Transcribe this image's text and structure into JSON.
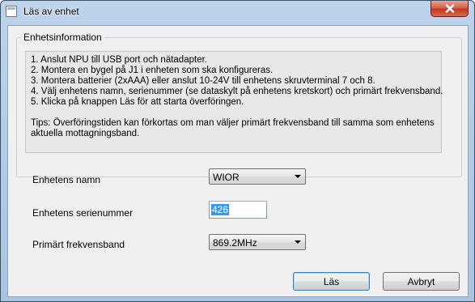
{
  "window": {
    "title": "Läs av enhet",
    "close_icon": "close-icon"
  },
  "groupbox": {
    "title": "Enhetsinformation",
    "instructions": [
      "1. Anslut NPU till USB port och nätadapter.",
      "2. Montera en bygel på J1 i enheten som ska konfigureras.",
      "3. Montera batterier (2xAAA) eller anslut 10-24V till enhetens skruvterminal 7 och 8.",
      "4. Välj enhetens namn, serienummer (se dataskylt på enhetens kretskort) och primärt frekvensband.",
      "5. Klicka på knappen Läs för att starta överföringen."
    ],
    "tips_line1": "Tips: Överföringstiden kan förkortas om man väljer primärt frekvensband till samma som enhetens",
    "tips_line2": "aktuella mottagningsband."
  },
  "form": {
    "device_name_label": "Enhetens namn",
    "device_name_value": "WIOR",
    "serial_label": "Enhetens serienummer",
    "serial_value": "426",
    "band_label": "Primärt frekvensband",
    "band_value": "869.2MHz"
  },
  "buttons": {
    "read_label": "Läs",
    "cancel_label": "Avbryt"
  }
}
